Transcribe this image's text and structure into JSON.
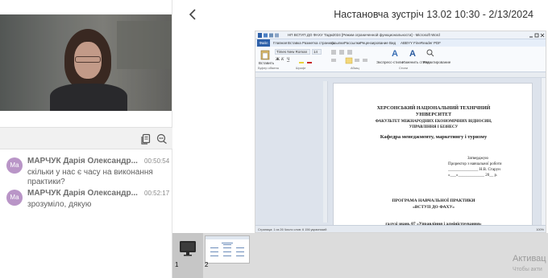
{
  "header": {
    "meeting_title": "Настановча зустріч 13.02 10:30 - 2/13/2024"
  },
  "chat": {
    "messages": [
      {
        "avatar": "Ма",
        "sender": "МАРЧУК Дарія Олександр...",
        "time": "00:50:54",
        "text": "скільки у нас є часу на виконання практики?"
      },
      {
        "avatar": "Ма",
        "sender": "МАРЧУК Дарія Олександр...",
        "time": "00:52:17",
        "text": "зрозуміло, дякую"
      }
    ]
  },
  "word": {
    "window_title": "НП ВСТУП ДО ФАХУ Тадм2024 [Режим ограниченной функциональности] - Microsoft Word",
    "file_tab": "Файл",
    "tabs": [
      "Главная",
      "Вставка",
      "Разметка страницы",
      "Ссылки",
      "Рассылки",
      "Рецензирование",
      "Вид",
      "ABBYY FineReader PDF"
    ],
    "font_name": "Times New Roman",
    "font_size": "14",
    "paste_label": "Вставить",
    "styles_label": "Экспресс-стили",
    "change_styles_label": "Изменить стили",
    "editing_label": "Редактирование",
    "group_clipboard": "Буфер обмена",
    "group_font": "Шрифт",
    "group_paragraph": "Абзац",
    "group_styles": "Стили",
    "status_left": "Страница: 1 из 26   Число слов: 6 156   украинский",
    "status_zoom": "100%",
    "page": {
      "line1": "ХЕРСОНСЬКИЙ НАЦІОНАЛЬНИЙ ТЕХНІЧНИЙ",
      "line2": "УНІВЕРСИТЕТ",
      "line3": "ФАКУЛЬТЕТ МІЖНАРОДНИХ ЕКОНОМІЧНИХ ВІДНОСИН,",
      "line4": "УПРАВЛІННЯ І БІЗНЕСУ",
      "line5": "Кафедра менеджменту,  маркетингу і туризму",
      "approve": "Затверджую",
      "approve2": "Проректор з навчальної роботи",
      "approve3": "_______________ Н.В. Старун",
      "approve4": "«___»_____________ 20__ р.",
      "program1": "ПРОГРАМА НАВЧАЛЬНОЇ ПРАКТИКИ",
      "program2": "«ВСТУП ДО ФАХУ»",
      "cut": "галузі знань  07  «Управління і адміністрування»"
    }
  },
  "thumbnails": [
    {
      "number": "1"
    },
    {
      "number": "2"
    }
  ],
  "watermark": {
    "title": "Активац",
    "sub": "Чтобы акти"
  },
  "colors": {
    "avatar_bg": "#b995c7",
    "word_blue": "#2c5fa8",
    "strip_bg": "#dcdcdc"
  }
}
